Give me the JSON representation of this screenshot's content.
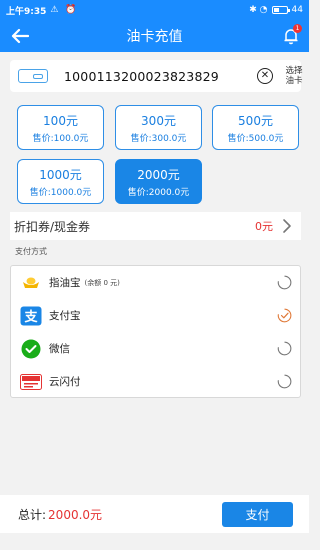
{
  "status_bar": {
    "time": "上午9:35",
    "left_icons": "⚠ ⏰",
    "right_icons": "✱ ◔",
    "battery": "44",
    "battery_level": 0.44
  },
  "header": {
    "title": "油卡充值",
    "notification_count": "1"
  },
  "card": {
    "number": "1000113200023823829",
    "clear_symbol": "✕",
    "select_label": "选择油卡"
  },
  "amounts": [
    {
      "amount": "100元",
      "price": "售价:100.0元",
      "selected": false
    },
    {
      "amount": "300元",
      "price": "售价:300.0元",
      "selected": false
    },
    {
      "amount": "500元",
      "price": "售价:500.0元",
      "selected": false
    },
    {
      "amount": "1000元",
      "price": "售价:1000.0元",
      "selected": false
    },
    {
      "amount": "2000元",
      "price": "售价:2000.0元",
      "selected": true
    }
  ],
  "discount": {
    "label": "折扣券/现金券",
    "value": "0元"
  },
  "payment": {
    "section_label": "支付方式",
    "methods": [
      {
        "name": "指油宝",
        "sub": "(余额 0 元)",
        "selected": false,
        "icon": "gold-ingot-icon"
      },
      {
        "name": "支付宝",
        "sub": "",
        "selected": true,
        "icon": "alipay-icon"
      },
      {
        "name": "微信",
        "sub": "",
        "selected": false,
        "icon": "wechat-icon"
      },
      {
        "name": "云闪付",
        "sub": "",
        "selected": false,
        "icon": "unionpay-icon"
      }
    ]
  },
  "footer": {
    "total_label": "总计:",
    "total_amount": "2000.0元",
    "pay_button": "支付"
  },
  "colors": {
    "primary": "#1a8cff",
    "accent_red": "#e53333",
    "radio_selected": "#e07a3a"
  }
}
